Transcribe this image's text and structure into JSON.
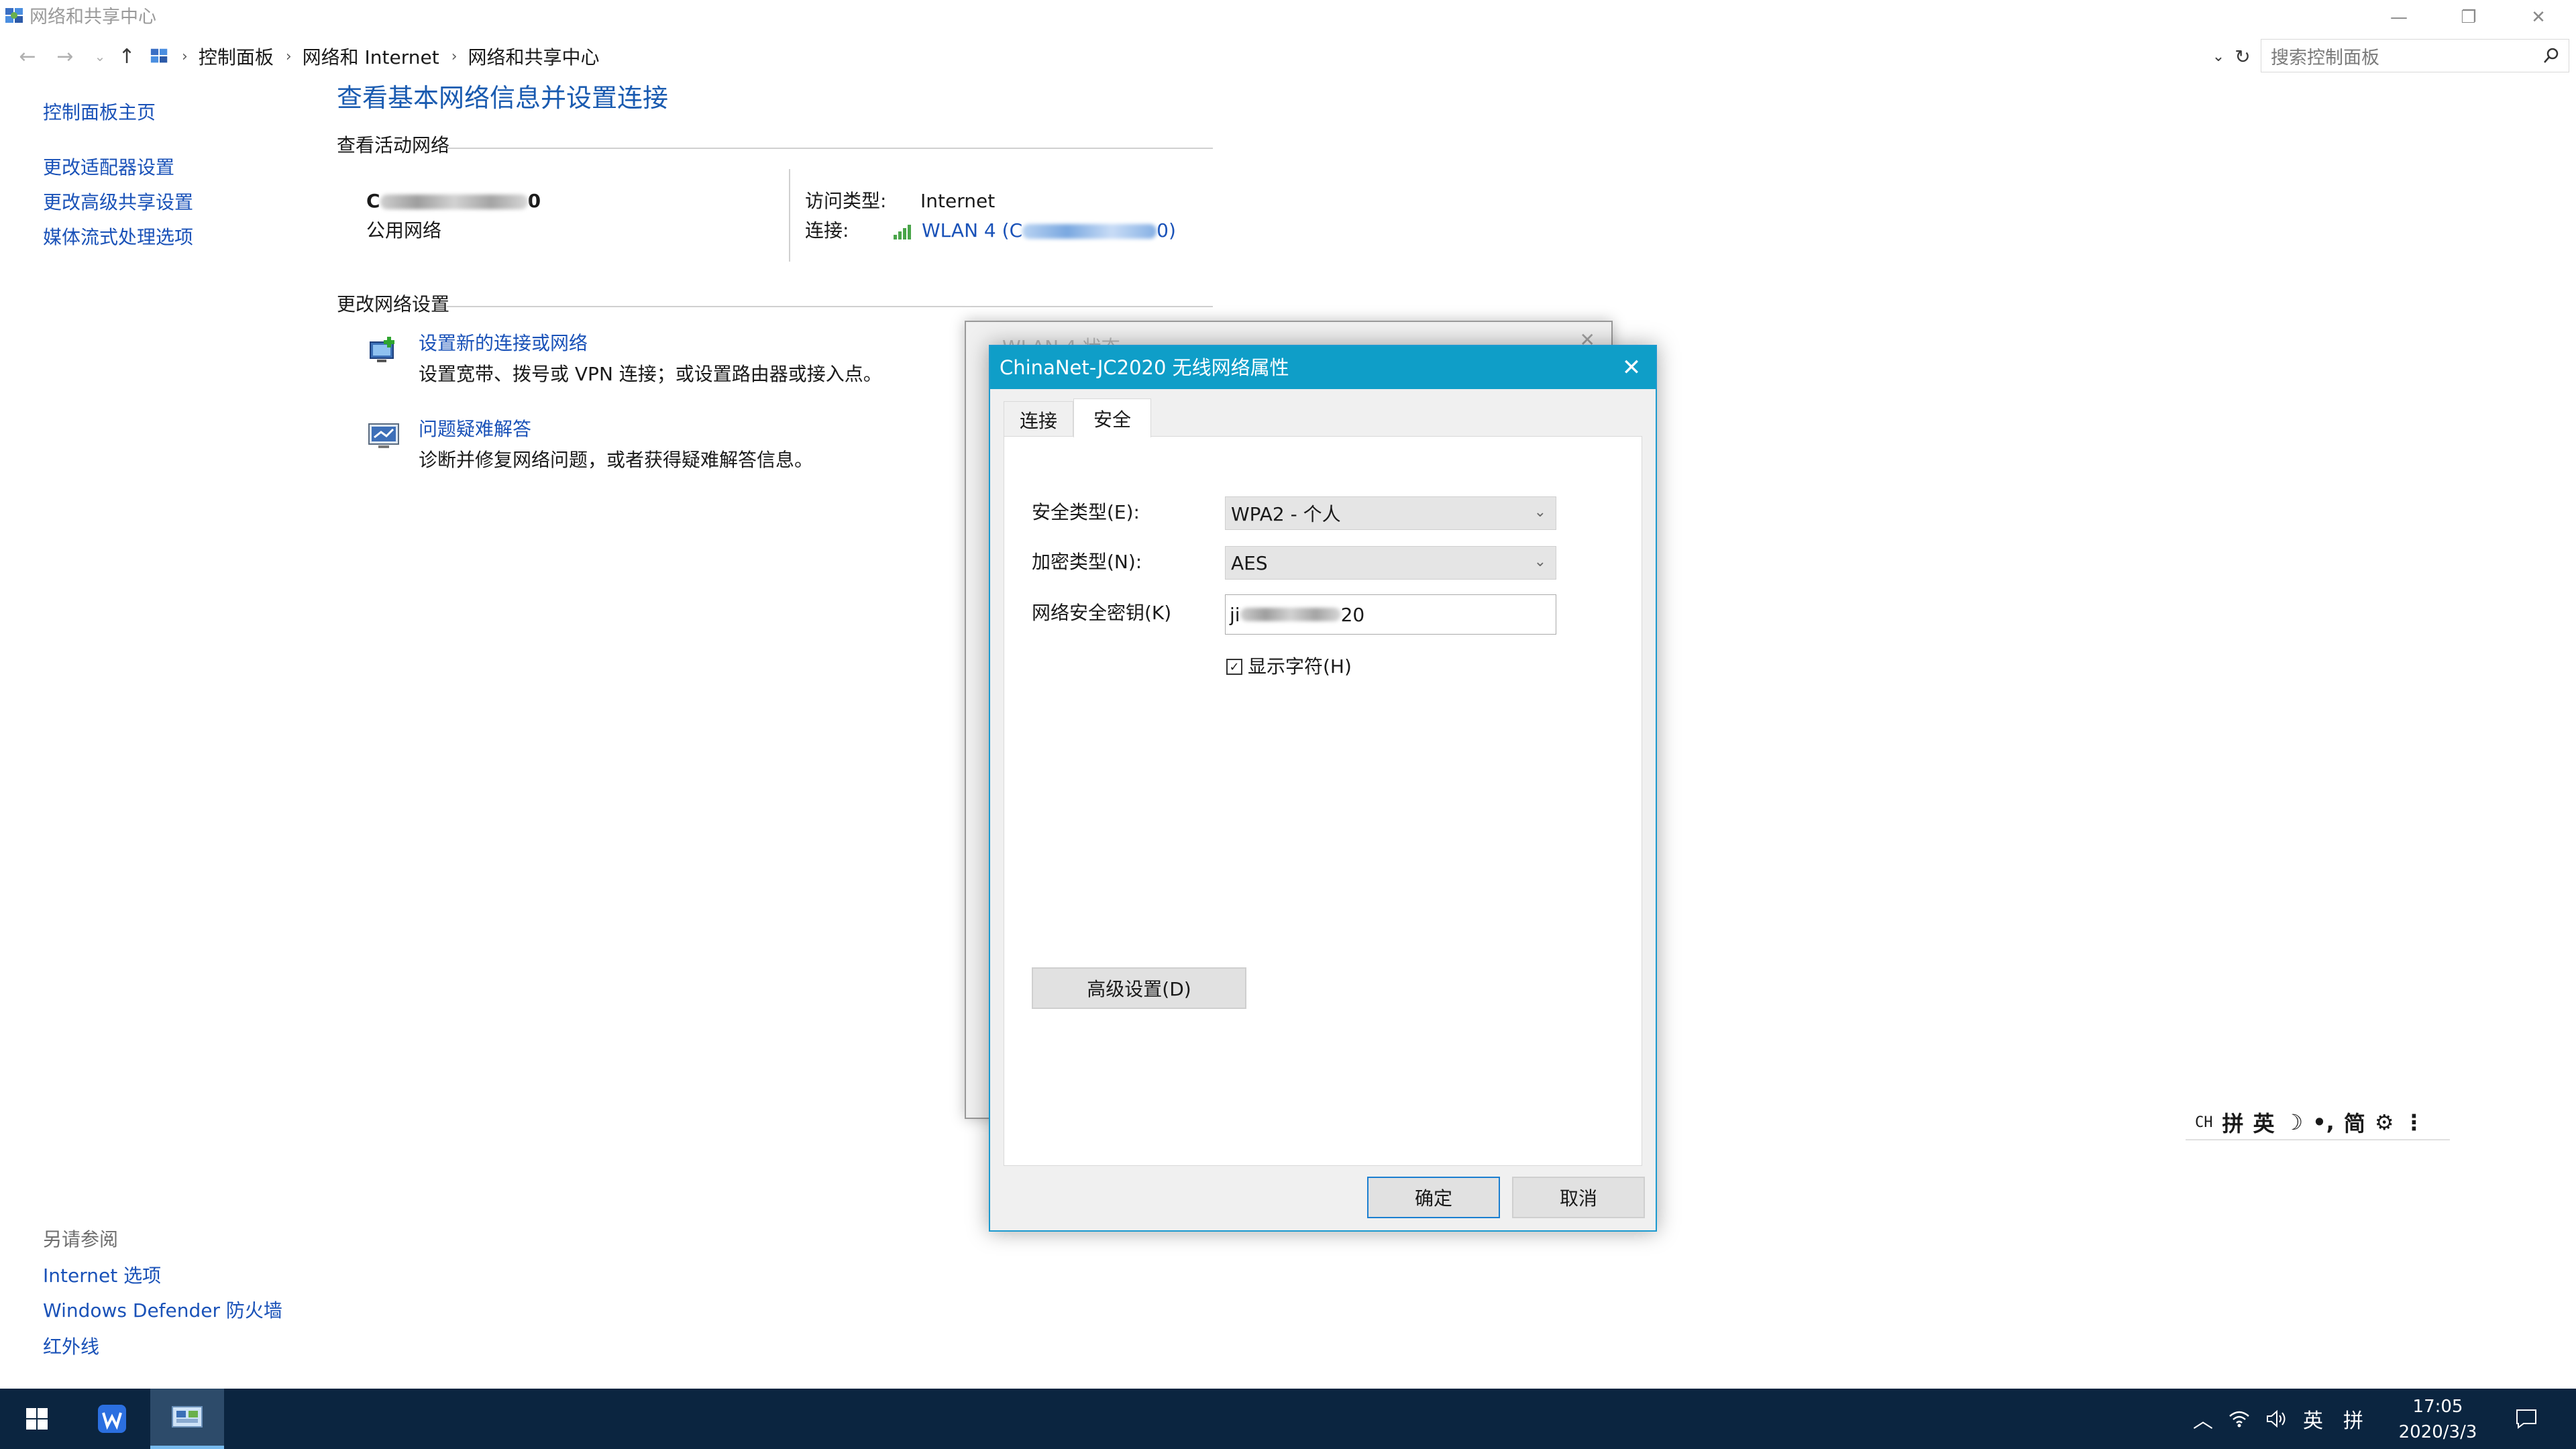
{
  "window": {
    "title": "网络和共享中心",
    "controls": {
      "minimize": "—",
      "restore": "❐",
      "close": "✕"
    }
  },
  "address": {
    "breadcrumbs": [
      "控制面板",
      "网络和 Internet",
      "网络和共享中心"
    ],
    "search_placeholder": "搜索控制面板"
  },
  "sidebar": {
    "items": [
      "控制面板主页",
      "更改适配器设置",
      "更改高级共享设置",
      "媒体流式处理选项"
    ],
    "see_also_heading": "另请参阅",
    "see_also": [
      "Internet 选项",
      "Windows Defender 防火墙",
      "红外线"
    ]
  },
  "main": {
    "title": "查看基本网络信息并设置连接",
    "active_networks_label": "查看活动网络",
    "network_name_visible": "C",
    "network_name_suffix": "0",
    "network_type": "公用网络",
    "access_type_label": "访问类型:",
    "access_type_value": "Internet",
    "connection_label": "连接:",
    "connection_value_prefix": "WLAN 4 (C",
    "connection_value_suffix": "0)",
    "change_settings_label": "更改网络设置",
    "tasks": [
      {
        "title": "设置新的连接或网络",
        "desc": "设置宽带、拨号或 VPN 连接；或设置路由器或接入点。"
      },
      {
        "title": "问题疑难解答",
        "desc": "诊断并修复网络问题，或者获得疑难解答信息。"
      }
    ]
  },
  "bg_dialog": {
    "title": "WLAN 4 状态"
  },
  "dialog": {
    "title": "ChinaNet-JC2020 无线网络属性",
    "tabs": [
      "连接",
      "安全"
    ],
    "active_tab": "安全",
    "security_type_label": "安全类型(E):",
    "security_type_value": "WPA2 - 个人",
    "encryption_type_label": "加密类型(N):",
    "encryption_type_value": "AES",
    "key_label": "网络安全密钥(K)",
    "key_prefix": "ji",
    "key_suffix": "20",
    "show_chars_label": "显示字符(H)",
    "show_chars_checked": true,
    "advanced_button": "高级设置(D)",
    "ok_button": "确定",
    "cancel_button": "取消"
  },
  "ime_bar": {
    "items": [
      "CH",
      "拼",
      "英",
      "☽",
      "•,",
      "简",
      "⚙",
      "⋮"
    ]
  },
  "taskbar": {
    "tray_ime_lang": "英",
    "tray_ime_mode": "拼",
    "clock_time": "17:05",
    "clock_date": "2020/3/3"
  },
  "colors": {
    "accent": "#0f9ec8",
    "link": "#1a52b8",
    "taskbar": "#0b2540"
  }
}
